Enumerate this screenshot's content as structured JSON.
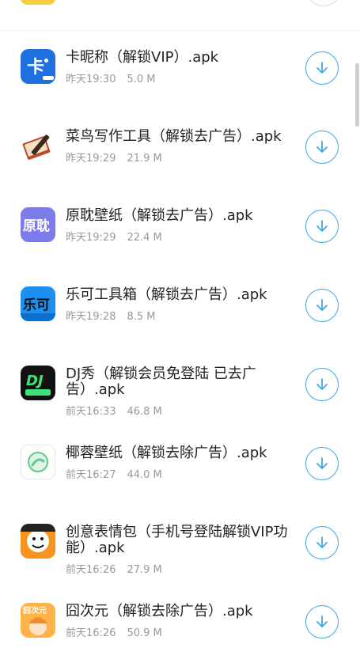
{
  "items": [
    {
      "title": "卡昵称（解锁VIP）.apk",
      "date": "昨天19:30",
      "size": "5.0 M",
      "icon": "kanicheng-app-icon",
      "icon_text": "卡昵称"
    },
    {
      "title": "菜鸟写作工具（解锁去广告）.apk",
      "date": "昨天19:29",
      "size": "21.9 M",
      "icon": "notebook-pencil-app-icon"
    },
    {
      "title": "原耽壁纸（解锁去广告）.apk",
      "date": "昨天19:29",
      "size": "22.4 M",
      "icon": "yuandan-app-icon",
      "icon_text": "原耽"
    },
    {
      "title": "乐可工具箱（解锁去广告）.apk",
      "date": "昨天19:28",
      "size": "8.5 M",
      "icon": "leke-app-icon",
      "icon_text": "乐可"
    },
    {
      "title": "DJ秀（解锁会员免登陆 已去广告）.apk",
      "date": "前天16:33",
      "size": "46.8 M",
      "icon": "dj-app-icon",
      "icon_text": "DJ",
      "icon_subtext": "串烧版"
    },
    {
      "title": "椰蓉壁纸（解锁去除广告）.apk",
      "date": "前天16:27",
      "size": "44.0 M",
      "icon": "yerong-app-icon"
    },
    {
      "title": "创意表情包（手机号登陆解锁VIP功能）.apk",
      "date": "前天16:26",
      "size": "27.9 M",
      "icon": "meme-face-app-icon"
    },
    {
      "title": "囧次元（解锁去除广告）.apk",
      "date": "前天16:26",
      "size": "50.9 M",
      "icon": "jiongciyuan-app-icon",
      "icon_text": "囧次元"
    }
  ],
  "colors": {
    "accent": "#3fa8e6",
    "title": "#222222",
    "meta": "#999999"
  }
}
